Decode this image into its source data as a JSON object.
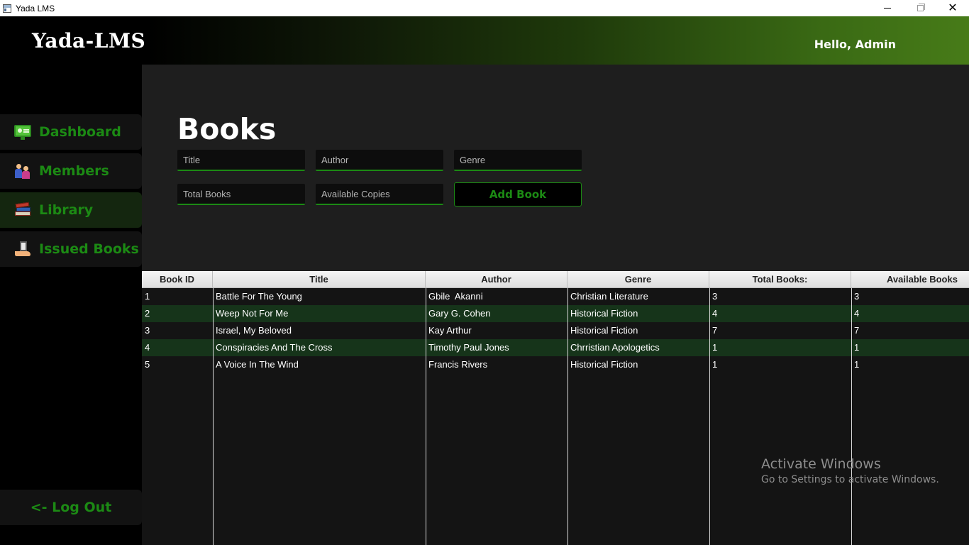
{
  "window": {
    "title": "Yada LMS"
  },
  "header": {
    "brand": "Yada-LMS",
    "greeting": "Hello, Admin"
  },
  "sidebar": {
    "items": [
      {
        "label": "Dashboard",
        "icon": "dashboard-icon",
        "active": false
      },
      {
        "label": "Members",
        "icon": "members-icon",
        "active": false
      },
      {
        "label": "Library",
        "icon": "library-icon",
        "active": true
      },
      {
        "label": "Issued Books",
        "icon": "issued-books-icon",
        "active": false
      }
    ],
    "logout_label": "<- Log Out"
  },
  "main": {
    "title": "Books",
    "form": {
      "title_placeholder": "Title",
      "author_placeholder": "Author",
      "genre_placeholder": "Genre",
      "total_placeholder": "Total Books",
      "available_placeholder": "Available Copies",
      "add_button": "Add Book"
    }
  },
  "table": {
    "columns": [
      "Book ID",
      "Title",
      "Author",
      "Genre",
      "Total Books:",
      "Available Books"
    ],
    "rows": [
      [
        "1",
        "Battle For The Young",
        "Gbile  Akanni",
        "Christian Literature",
        "3",
        "3"
      ],
      [
        "2",
        "Weep Not For Me",
        "Gary G. Cohen",
        "Historical Fiction",
        "4",
        "4"
      ],
      [
        "3",
        "Israel, My Beloved",
        "Kay Arthur",
        "Historical Fiction",
        "7",
        "7"
      ],
      [
        "4",
        "Conspiracies And The Cross",
        "Timothy Paul Jones",
        "Chrristian Apologetics",
        "1",
        "1"
      ],
      [
        "5",
        "A Voice In The Wind",
        "Francis Rivers",
        "Historical Fiction",
        "1",
        "1"
      ]
    ]
  },
  "watermark": {
    "line1": "Activate Windows",
    "line2": "Go to Settings to activate Windows."
  },
  "colors": {
    "accent": "#1c8a14",
    "header_gradient_end": "#477b18",
    "row_alt": "#16341a",
    "panel": "#1e1e1e"
  }
}
